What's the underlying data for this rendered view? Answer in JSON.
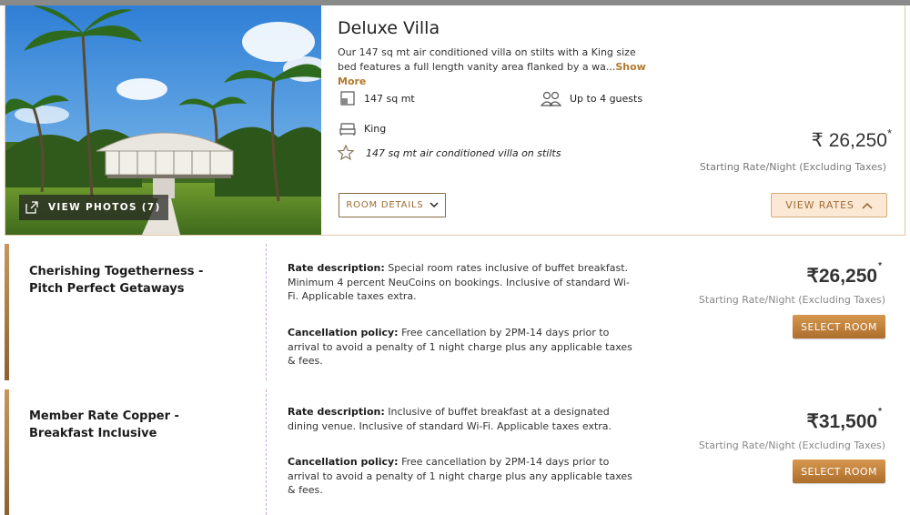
{
  "room": {
    "title": "Deluxe Villa",
    "description": "Our 147 sq mt air conditioned villa on stilts with a King size bed features a full length vanity area flanked by a wa...",
    "show_more": "Show More",
    "view_photos": "VIEW PHOTOS (7)",
    "features": {
      "area": "147 sq mt",
      "guests": "Up to 4 guests",
      "bed": "King",
      "highlight": "147 sq mt air conditioned villa on stilts"
    },
    "price": "₹ 26,250",
    "price_mark": "*",
    "price_note": "Starting Rate/Night (Excluding Taxes)",
    "room_details_label": "ROOM DETAILS",
    "view_rates_label": "VIEW RATES"
  },
  "rates": [
    {
      "name": "Cherishing Togetherness - Pitch Perfect Getaways",
      "rate_label": "Rate description:",
      "rate_desc": " Special room rates inclusive of buffet breakfast. Minimum 4 percent NeuCoins on bookings. Inclusive of standard Wi-Fi. Applicable taxes extra.",
      "cancel_label": "Cancellation policy:",
      "cancel_desc": " Free cancellation by 2PM-14 days prior to arrival to avoid a penalty of 1 night charge plus any applicable taxes & fees.",
      "price": "₹26,250",
      "price_mark": "*",
      "note": "Starting Rate/Night (Excluding Taxes)",
      "button": "SELECT ROOM"
    },
    {
      "name": "Member Rate Copper - Breakfast Inclusive",
      "rate_label": "Rate description:",
      "rate_desc": " Inclusive of buffet breakfast at a designated dining venue. Inclusive of standard Wi-Fi. Applicable taxes extra.",
      "cancel_label": "Cancellation policy:",
      "cancel_desc": " Free cancellation by 2PM-14 days prior to arrival to avoid a penalty of 1 night charge plus any applicable taxes & fees.",
      "price": "₹31,500",
      "price_mark": "*",
      "note": "Starting Rate/Night (Excluding Taxes)",
      "button": "SELECT ROOM"
    }
  ],
  "colors": {
    "accent": "#b07a2c",
    "select_button": "#c17f39",
    "view_rates_bg": "#fbe9d6"
  }
}
